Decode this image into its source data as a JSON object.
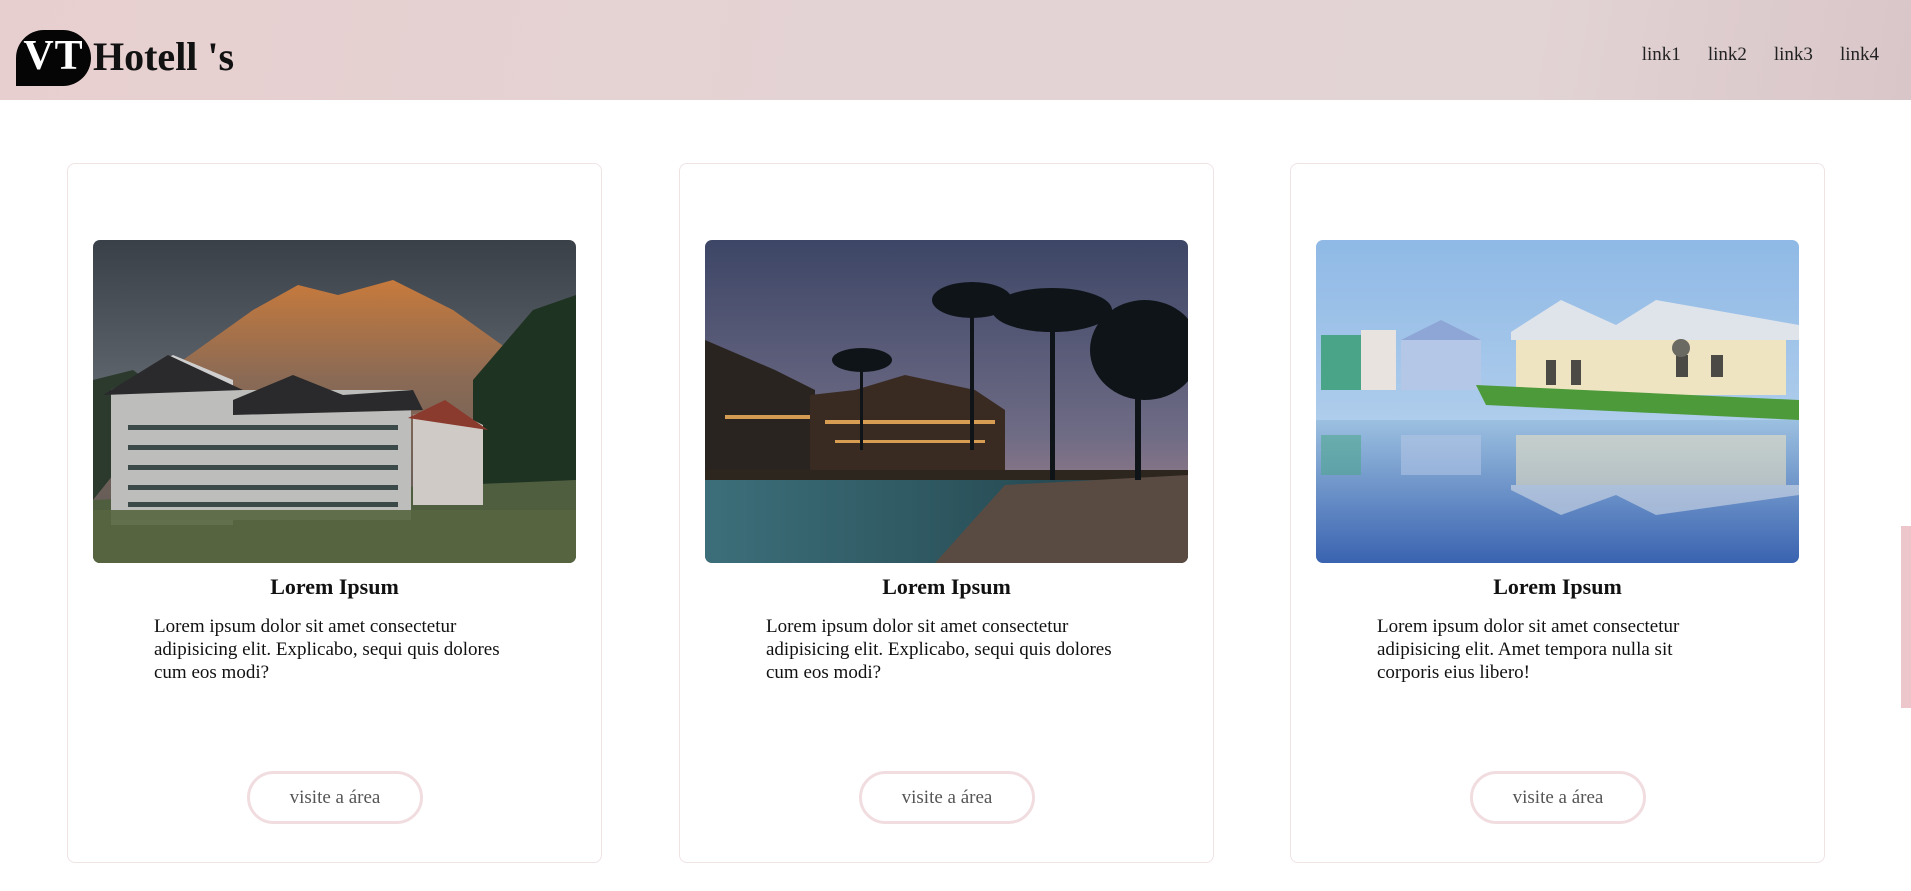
{
  "header": {
    "logo_badge": "VT",
    "logo_text": "Hotell 's",
    "nav": [
      "link1",
      "link2",
      "link3",
      "link4"
    ]
  },
  "cards": [
    {
      "image": "mountain-hotel-photo",
      "title": "Lorem Ipsum",
      "text": "Lorem ipsum dolor sit amet consectetur adipisicing elit. Explicabo, sequi quis dolores cum eos modi?",
      "button": "visite a área"
    },
    {
      "image": "tropical-resort-pool-photo",
      "title": "Lorem Ipsum",
      "text": "Lorem ipsum dolor sit amet consectetur adipisicing elit. Explicabo, sequi quis dolores cum eos modi?",
      "button": "visite a área"
    },
    {
      "image": "waterfront-house-photo",
      "title": "Lorem Ipsum",
      "text": "Lorem ipsum dolor sit amet consectetur adipisicing elit. Amet tempora nulla sit corporis eius libero!",
      "button": "visite a área"
    }
  ],
  "colors": {
    "header_bg": "#e4d3d4",
    "button_border": "#f1dde0",
    "accent_scroll": "#ecc6cb"
  }
}
